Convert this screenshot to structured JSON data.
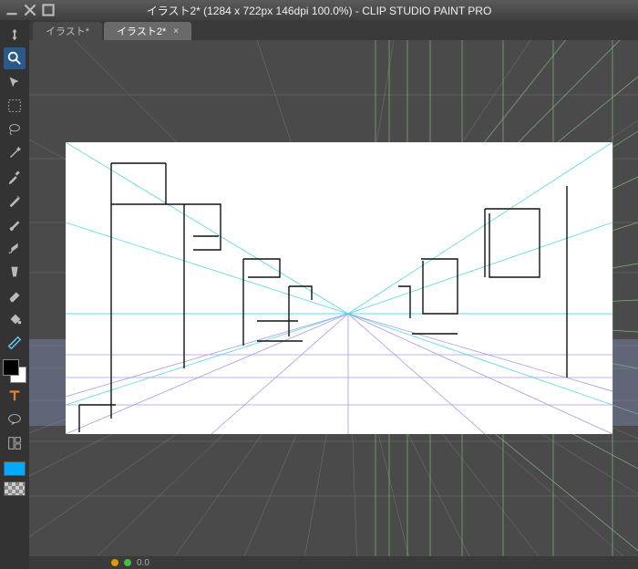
{
  "window": {
    "title": "イラスト2* (1284 x 722px 146dpi 100.0%)  - CLIP STUDIO PAINT PRO"
  },
  "tabs": [
    {
      "label": "イラスト*",
      "active": false
    },
    {
      "label": "イラスト2*",
      "active": true
    }
  ],
  "status": {
    "value": "0.0"
  },
  "tools": [
    "zoom",
    "move",
    "object",
    "marquee",
    "lasso",
    "wand",
    "eyedropper",
    "pen",
    "brush",
    "airbrush",
    "blend",
    "erase",
    "fill",
    "gradient",
    "ruler",
    "text",
    "balloon"
  ]
}
